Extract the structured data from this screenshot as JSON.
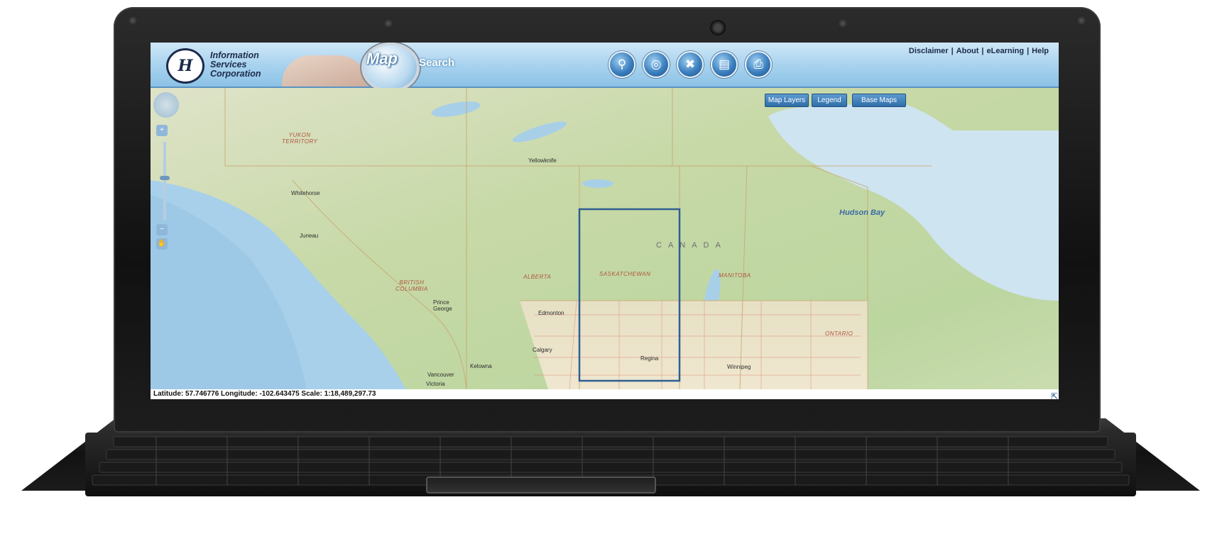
{
  "header": {
    "logo_mark": "H",
    "org_name": "Information\nServices\nCorporation",
    "app_word_map": "Map",
    "app_word_search": "Search"
  },
  "toolbar": {
    "tools": [
      {
        "name": "search-tool",
        "icon": "magnifier-icon"
      },
      {
        "name": "measure-tool",
        "icon": "compass-icon"
      },
      {
        "name": "tools-tool",
        "icon": "wrench-icon"
      },
      {
        "name": "bookmark-tool",
        "icon": "book-icon"
      },
      {
        "name": "print-tool",
        "icon": "printer-icon"
      }
    ]
  },
  "top_links": {
    "disclaimer": "Disclaimer",
    "about": "About",
    "elearning": "eLearning",
    "help": "Help",
    "separator": "|"
  },
  "map_buttons": {
    "layers": "Map Layers",
    "legend": "Legend",
    "base_maps": "Base Maps"
  },
  "map": {
    "region_label": "CANADA",
    "water": {
      "hudson_bay": "Hudson\nBay"
    },
    "provinces": {
      "yukon": "YUKON\nTERRITORY",
      "british_columbia": "BRITISH\nCOLUMBIA",
      "alberta": "ALBERTA",
      "saskatchewan": "SASKATCHEWAN",
      "manitoba": "MANITOBA",
      "ontario": "ONTARIO"
    },
    "cities": {
      "yellowknife": "Yellowknife",
      "whitehorse": "Whitehorse",
      "juneau": "Juneau",
      "prince_george": "Prince\nGeorge",
      "edmonton": "Edmonton",
      "calgary": "Calgary",
      "kelowna": "Kelowna",
      "vancouver": "Vancouver",
      "victoria": "Victoria",
      "regina": "Regina",
      "winnipeg": "Winnipeg"
    }
  },
  "status": {
    "coords_text": "Latitude: 57.746776 Longitude: -102.643475   Scale: 1:18,489,297.73"
  },
  "colors": {
    "header_blue": "#a9d3ef",
    "button_blue": "#2f6ea8",
    "selection_box": "#2f5e93"
  }
}
